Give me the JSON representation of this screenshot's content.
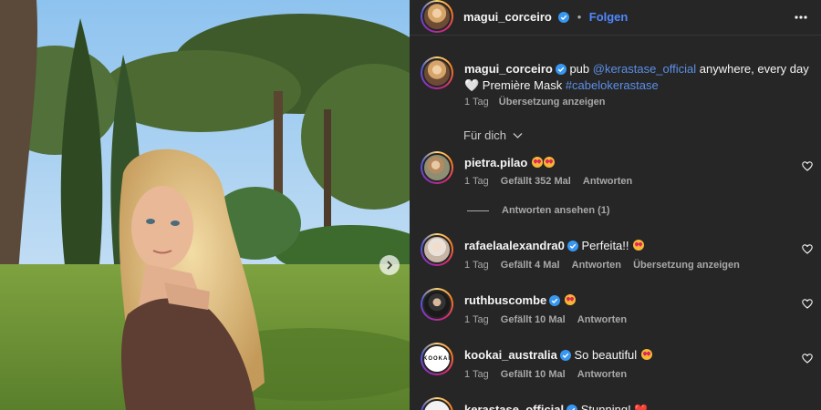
{
  "header": {
    "username": "magui_corceiro",
    "separator": "•",
    "follow_label": "Folgen"
  },
  "caption": {
    "username": "magui_corceiro",
    "text_before": " pub ",
    "mention": "@kerastase_official",
    "text_middle": " anywhere, every day 🤍 Première Mask ",
    "hashtag": "#cabelokerastase",
    "time": "1 Tag",
    "translate_label": "Übersetzung anzeigen"
  },
  "sort": {
    "label": "Für dich"
  },
  "comments": [
    {
      "username": "pietra.pilao",
      "verified": false,
      "text": "",
      "emoji_count": 2,
      "time": "1 Tag",
      "likes": "Gefällt 352 Mal",
      "reply_label": "Antworten",
      "view_replies": "Antworten ansehen (1)"
    },
    {
      "username": "rafaelaalexandra0",
      "verified": true,
      "text": "Perfeita!!",
      "emoji_count": 1,
      "time": "1 Tag",
      "likes": "Gefällt 4 Mal",
      "reply_label": "Antworten",
      "translate_label": "Übersetzung anzeigen"
    },
    {
      "username": "ruthbuscombe",
      "verified": true,
      "text": "",
      "emoji_count": 1,
      "time": "1 Tag",
      "likes": "Gefällt 10 Mal",
      "reply_label": "Antworten"
    },
    {
      "username": "kookai_australia",
      "verified": true,
      "text": "So beautiful",
      "emoji_count": 1,
      "time": "1 Tag",
      "likes": "Gefällt 10 Mal",
      "reply_label": "Antworten",
      "avatar_logo": "KOOKAÏ"
    },
    {
      "username": "kerastase_official",
      "verified": true,
      "text": "Stunning!",
      "emoji_heart": "❤️"
    }
  ],
  "colors": {
    "panel_bg": "#262626",
    "link": "#5b8fe8",
    "follow": "#4f88ff",
    "verified": "#3897f0",
    "muted": "#a8a8a8"
  },
  "icons": {
    "more": "more-options-icon",
    "verified": "verified-badge-icon",
    "heart": "heart-outline-icon",
    "chevron": "chevron-down-icon",
    "next": "chevron-right-icon"
  }
}
